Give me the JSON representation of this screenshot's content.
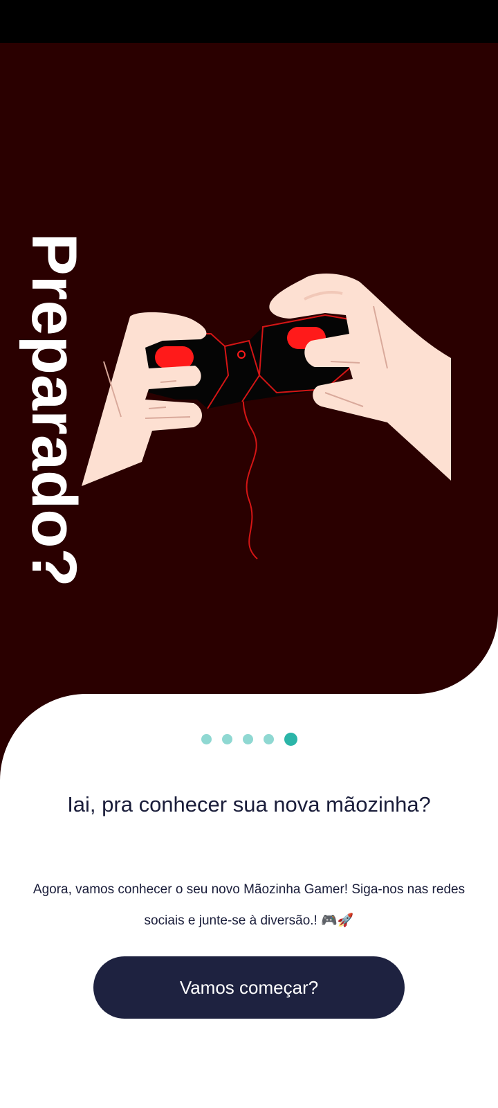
{
  "colors": {
    "hero_bg": "#2a0000",
    "skin": "#fde0d2",
    "accent_red": "#ff1a1a",
    "dot_inactive": "#8fd8d2",
    "dot_active": "#2bb5a8",
    "text_dark": "#1a1d3a",
    "button_bg": "#1e2240"
  },
  "hero": {
    "title": "Preparado?",
    "illustration": "hands-holding-game-controller"
  },
  "pager": {
    "total": 5,
    "active_index": 4
  },
  "content": {
    "headline": "Iai, pra conhecer sua nova mãozinha?",
    "body": "Agora, vamos conhecer o seu novo Mãozinha Gamer! Siga-nos nas redes sociais e junte-se à diversão.! 🎮🚀"
  },
  "cta": {
    "label": "Vamos começar?"
  }
}
